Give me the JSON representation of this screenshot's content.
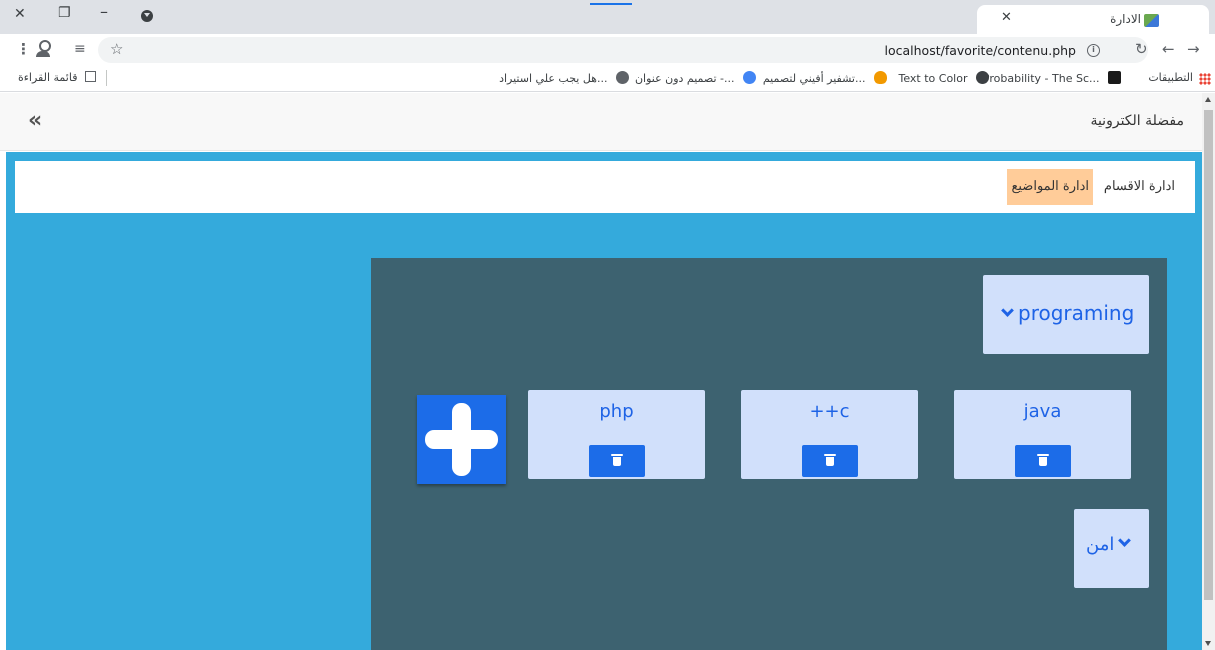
{
  "browser": {
    "tab_title": "الادارة",
    "new_tab_label": "+",
    "url": "localhost/favorite/contenu.php",
    "bookmarks": [
      {
        "label": "التطبيقات",
        "icon": "apps-icon"
      },
      {
        "label": "Probability - The Sc...",
        "icon": "x-logo-icon",
        "color": "#1a1a1a"
      },
      {
        "label": "Text to Color",
        "icon": "w-logo-icon",
        "color": "#3c4043"
      },
      {
        "label": "تشفير أفيني لتصميم...",
        "icon": "flame-icon",
        "color": "#f29900"
      },
      {
        "label": "تصميم دون عنوان -...",
        "icon": "canva-icon",
        "color": "#4285f4"
      },
      {
        "label": "هل يجب علي استيراد...",
        "icon": "globe-icon",
        "color": "#5f6368"
      }
    ],
    "reading_list": "قائمة القراءة"
  },
  "app": {
    "brand": "مفضلة الكترونية",
    "collapse_symbol": "«",
    "nav": {
      "categories": "ادارة الاقسام",
      "topics": "ادارة المواضيع"
    }
  },
  "panel": {
    "categories": [
      {
        "label": "programing"
      },
      {
        "label": "امن"
      }
    ],
    "items": [
      {
        "label": "php"
      },
      {
        "label": "++c"
      },
      {
        "label": "java"
      }
    ]
  },
  "colors": {
    "content_bg": "#34aadc",
    "panel_bg": "#3d6270",
    "card_bg": "#d1e0fb",
    "primary": "#1c6ce8",
    "active_nav": "#ffcc99"
  }
}
